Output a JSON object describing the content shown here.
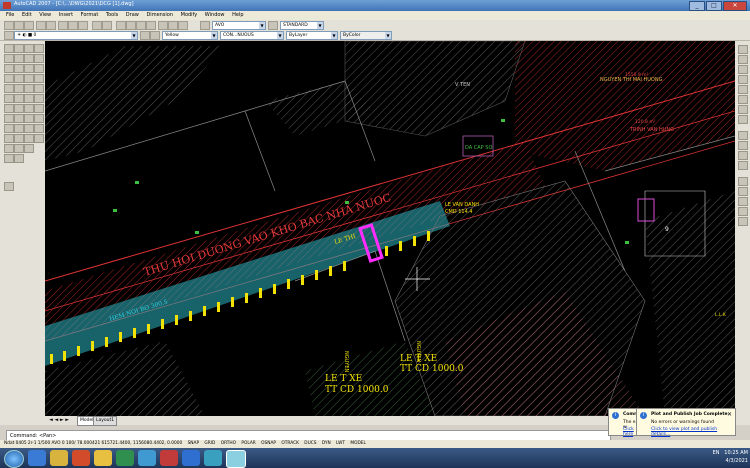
{
  "window": {
    "title": "AutoCAD 2007 - [C:\\...\\DWG\\2021\\DCG [1].dwg]",
    "minimize": "_",
    "maximize": "□",
    "close": "✕"
  },
  "menu": [
    "File",
    "Edit",
    "View",
    "Insert",
    "Format",
    "Tools",
    "Draw",
    "Dimension",
    "Modify",
    "Window",
    "Help"
  ],
  "toolbar": {
    "text_style": "AVO",
    "dim_style": "STANDARD",
    "layer_color": "Yellow",
    "linetype": "CON...NUOUS",
    "lineweight": "ByLayer",
    "plot_style": "ByColor"
  },
  "drawing": {
    "road_label": "THU HOI DUONG VAO KHO BAC NHA NUOC",
    "alley_label": "HEM NOI BO 300.5",
    "owner_1": "LE VAN DANH",
    "owner_1_cmnd": "CMD 114.4",
    "owner_name_top": "NGUYEN THI MAI HUONG",
    "owner_name_mid": "TRINH VAN HUNG",
    "area_top": "1550.9 m²",
    "area_mid": "120.8 m²",
    "small_label": "DA CAP SO",
    "le_thi_label": "LE THI",
    "le_thi_xe_1": "LE T XE",
    "tt_cd_1": "TT CD 1000.0",
    "le_thi_xe_2": "LE T XE",
    "tt_cd_2": "TT CD 1000.0",
    "nguyen_1": "NGUYEN",
    "nguyen_2": "NGUYEN",
    "parcel_9": "9",
    "road_side": "V TEN",
    "lot_label": "L.L.K"
  },
  "tabs": [
    "Model",
    "Layout1"
  ],
  "command": {
    "prompt": "Command: <Pan>"
  },
  "status": {
    "coords": "Ndat 0405 2r-1  1/500  AVO  0   100/  78.000421    615721.4400, 1156080.4402, 0.0000",
    "toggles": [
      "SNAP",
      "GRID",
      "ORTHO",
      "POLAR",
      "OSNAP",
      "OTRACK",
      "DUCS",
      "DYN",
      "LWT",
      "MODEL"
    ]
  },
  "notifications": {
    "plot_title": "Plot and Publish Job Complete",
    "plot_msg": "No errors or warnings found",
    "plot_link": "Click to view plot and publish details...",
    "comm_title": "Comm",
    "comm_msg": "The easy w",
    "comm_link": "Click here"
  },
  "taskbar": {
    "time": "10:25 AM",
    "date": "4/3/2021",
    "lang": "EN"
  }
}
